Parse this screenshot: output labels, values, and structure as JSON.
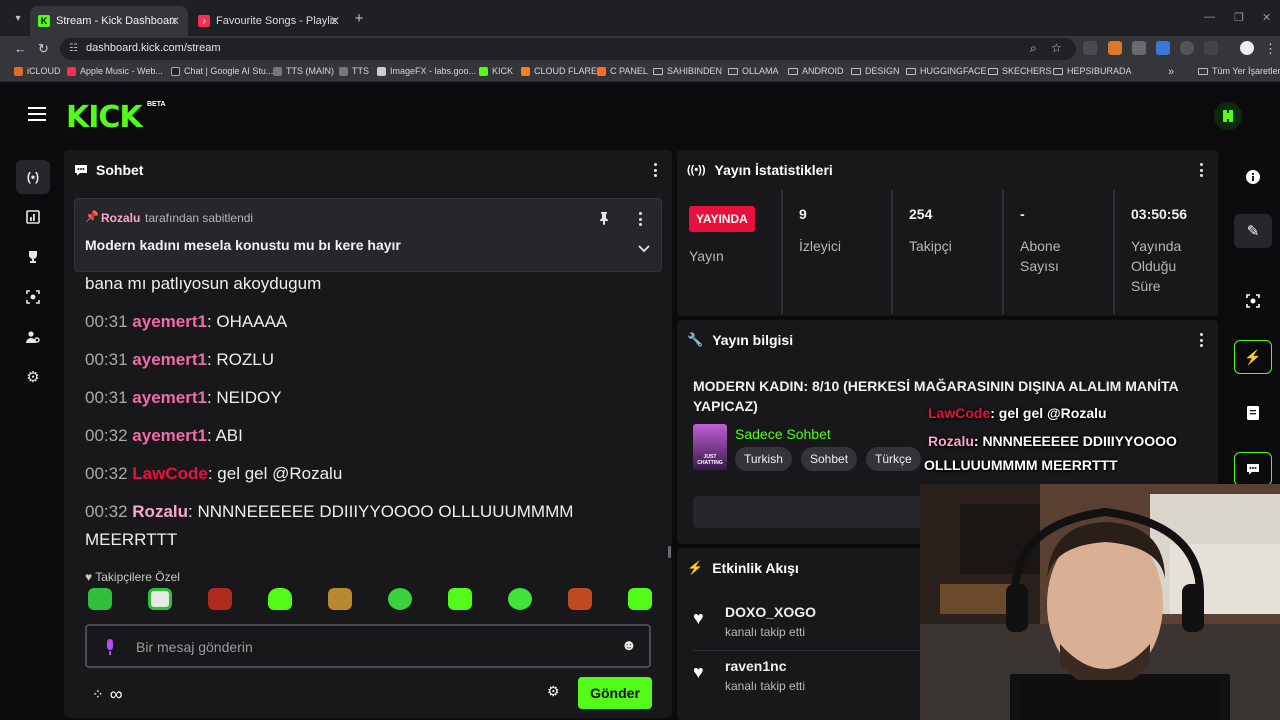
{
  "browser": {
    "tabs": [
      {
        "title": "Stream - Kick Dashboard",
        "active": true
      },
      {
        "title": "Favourite Songs - Playlist - Appl",
        "active": false
      }
    ],
    "url": "dashboard.kick.com/stream",
    "bookmarks": [
      "iCLOUD",
      "Apple Music - Web...",
      "Chat | Google AI Stu...",
      "TTS (MAIN)",
      "TTS",
      "ImageFX - labs.goo...",
      "KICK",
      "CLOUD FLARE",
      "C PANEL",
      "SAHIBINDEN",
      "OLLAMA",
      "ANDROID",
      "DESIGN",
      "HUGGINGFACE",
      "SKECHERS",
      "HEPSIBURADA"
    ],
    "bookmarks_overflow": "»",
    "all_bookmarks": "Tüm Yer İşaretleri"
  },
  "app": {
    "logo": "KICK",
    "logo_badge": "BETA",
    "accent": "#53fc18"
  },
  "chat": {
    "title": "Sohbet",
    "pinned": {
      "by_user": "Rozalu",
      "by_suffix": "tarafından sabitlendi",
      "message": "Modern kadını mesela konustu mu bı kere hayır"
    },
    "partial_line": "bana mı patlıyosun akoydugum",
    "messages": [
      {
        "time": "00:31",
        "user": "ayemert1",
        "color": "#f06ba8",
        "text": "OHAAAA"
      },
      {
        "time": "00:31",
        "user": "ayemert1",
        "color": "#f06ba8",
        "text": "ROZLU"
      },
      {
        "time": "00:31",
        "user": "ayemert1",
        "color": "#f06ba8",
        "text": "NEIDOY"
      },
      {
        "time": "00:32",
        "user": "ayemert1",
        "color": "#f06ba8",
        "text": "ABI"
      },
      {
        "time": "00:32",
        "user": "LawCode",
        "color": "#e9113c",
        "text": "gel gel @Rozalu"
      },
      {
        "time": "00:32",
        "user": "Rozalu",
        "color": "#f9a8c8",
        "text": "NNNNEEEEEE DDIIIYYOOOO OLLLUUUMMMM MEERRTTT"
      }
    ],
    "emote_section": "Takipçilere Özel",
    "input_placeholder": "Bir mesaj gönderin",
    "send_label": "Gönder"
  },
  "stats": {
    "title": "Yayın İstatistikleri",
    "live_badge": "YAYINDA",
    "cells": [
      {
        "value": "",
        "label": "Yayın"
      },
      {
        "value": "9",
        "label": "İzleyici"
      },
      {
        "value": "254",
        "label": "Takipçi"
      },
      {
        "value": "-",
        "label": "Abone Sayısı"
      },
      {
        "value": "03:50:56",
        "label": "Yayında Olduğu Süre"
      }
    ]
  },
  "stream_info": {
    "title": "Yayın bilgisi",
    "stream_title": "MODERN KADIN: 8/10 (HERKESİ MAĞARASININ DIŞINA ALALIM MANİTA YAPICAZ)",
    "category": "Sadece Sohbet",
    "category_thumb": "JUST CHATTING",
    "tags": [
      "Turkish",
      "Sohbet",
      "Türkçe"
    ]
  },
  "overlay": {
    "line1_user": "LawCode",
    "line1_text": ": gel gel @Rozalu",
    "line2_user": "Rozalu",
    "line2_text": ": NNNNEEEEEE DDIIIYYOOOO",
    "line3_text": "OLLLUUUMMMM MEERRTTT"
  },
  "activity": {
    "title": "Etkinlik Akışı",
    "events": [
      {
        "name": "DOXO_XOGO",
        "desc": "kanalı takip etti"
      },
      {
        "name": "raven1nc",
        "desc": "kanalı takip etti"
      }
    ]
  }
}
